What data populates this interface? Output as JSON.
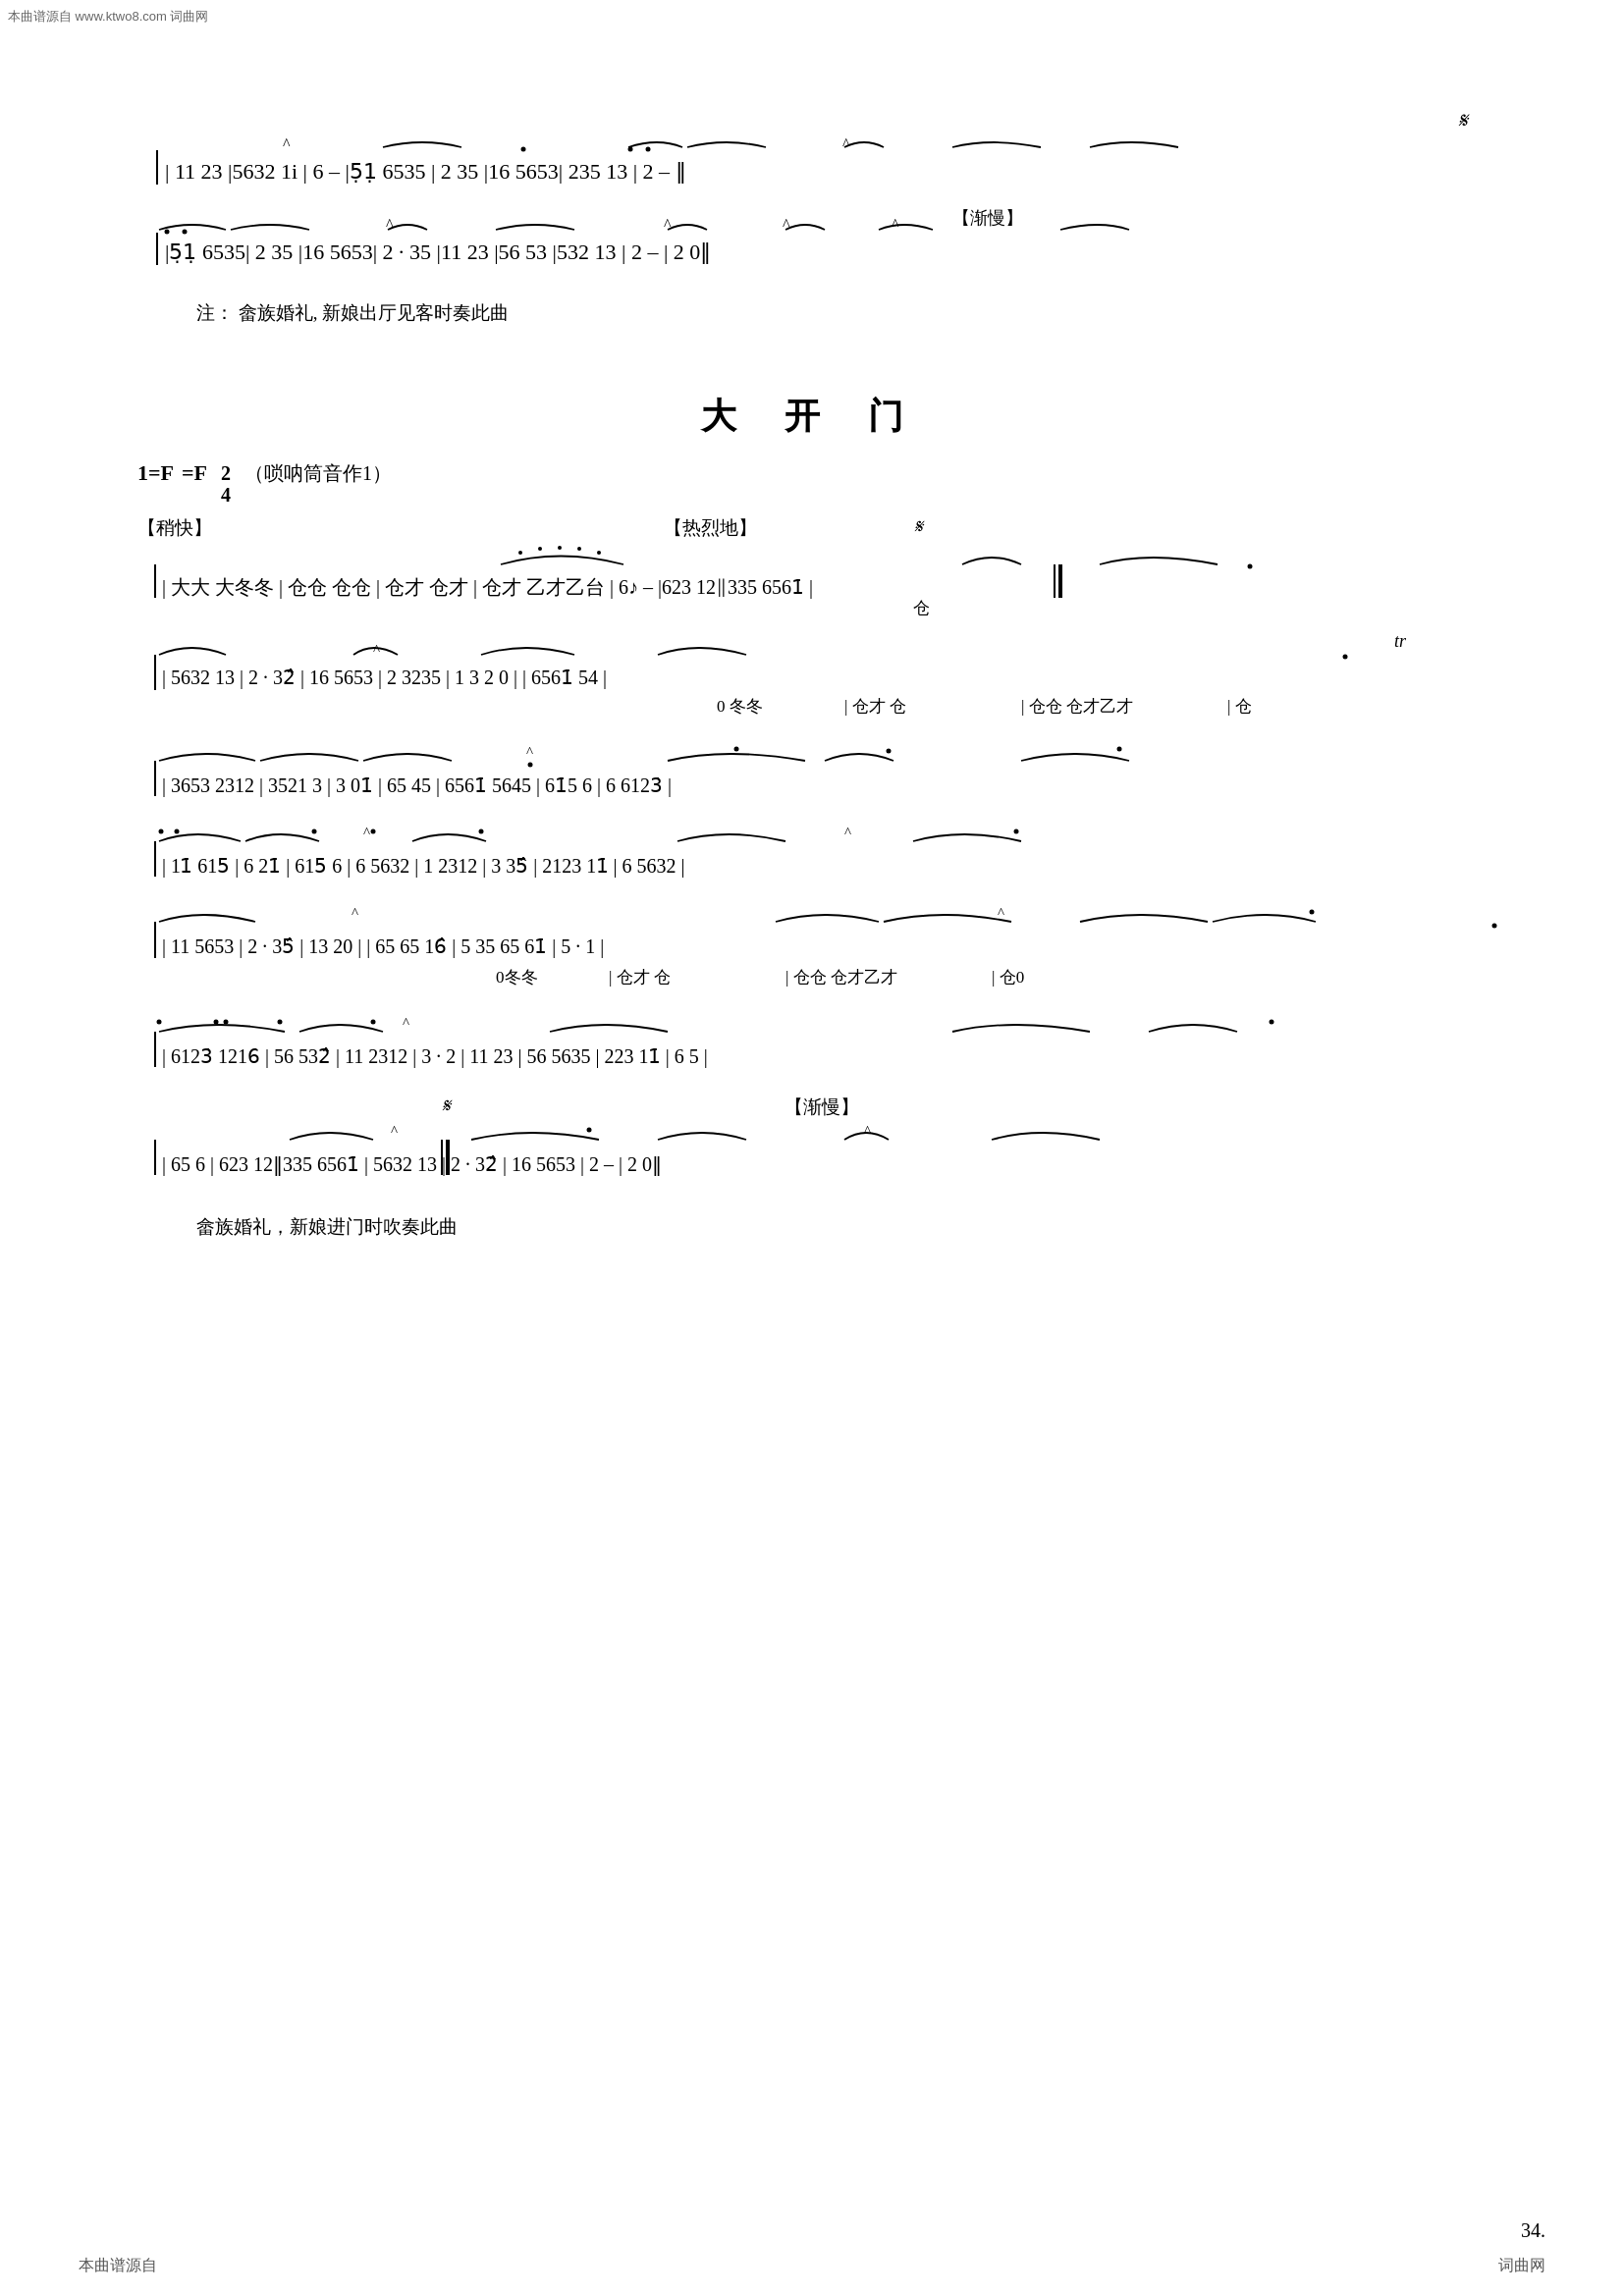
{
  "watermark": {
    "left": "本曲谱源自 www.ktwo8.com 词曲网",
    "right": ""
  },
  "section1": {
    "lines": [
      "| 11 23 |5632 1i̊| 6  –  |5̊1̊ 6535 | 2  35̂ |16 5653| 235 13 | 2  –  ‖",
      "|5̊1̊ 6535| 2  35̂ |16 5653| 2 · 35̂ |11 23̂ |56 53̂ |532 13 | 2  –  | 2  0‖"
    ],
    "note": "注：  畲族婚礼, 新娘出厅见客时奏此曲"
  },
  "section2": {
    "title": "大 开 门",
    "key": "1=F",
    "time": "2/4",
    "hint": "（唢呐筒音作1）",
    "tempos": {
      "kuai": "【稍快】",
      "rlie": "【热烈地】",
      "jman": "【渐慢】"
    },
    "lines": [
      {
        "main": "| 大大  大冬冬 | 仓仓  仓仓 | 仓才  仓才 |  仓才  乙才乙台 | 6%  –  |623 12‖335 6561̇ |",
        "sub": "                                                                    仓"
      },
      {
        "main": "| 5632 13 | 2 · 32̂ | 16 5653 | 2  3235 |  1 3   2 0  |              | 6561̇ 54 |",
        "sub": "                                          0 冬冬 | 仓才  仓 | 仓仓  仓才乙才 |  仓"
      },
      {
        "main": "| 3653 2312 | 3521  3 | 3  01̇ | 65 45 | 6561̇ 5645 | 61̇5  6 | 6  6123̇ |",
        "sub": ""
      },
      {
        "main": "| 11̇ 615̇ | 6  21̇ | 615̇  6 | 6  5632 | 1  2312 | 3  35̂ | 2123 11̇ | 6  5632 |",
        "sub": ""
      },
      {
        "main": "| 11 5653 | 2 · 35̂ | 13  20 |                       | 65 65  16̂ | 5  35 65  61̇ | 5 · 1  |",
        "sub": "                        0冬冬 | 仓才  仓 | 仓仓  仓才乙才 | 仓0"
      },
      {
        "main": "| 6123̇  1216̇ | 56 532̂ | 11 2312 | 3 · 2 | 11 23 | 56 5635 | 223 11̇ | 6  5 |",
        "sub": ""
      },
      {
        "main": "| 65  6  | 623 12‖335 6561̇ | 5632 13 | 2 · 32̂ | 16 5653 | 2  –  | 2  0‖",
        "sub": ""
      }
    ],
    "footer_note": "畲族婚礼，新娘进门时吹奏此曲"
  },
  "page_number": "34.",
  "footer": {
    "left": "本曲谱源自",
    "right": "词曲网"
  }
}
